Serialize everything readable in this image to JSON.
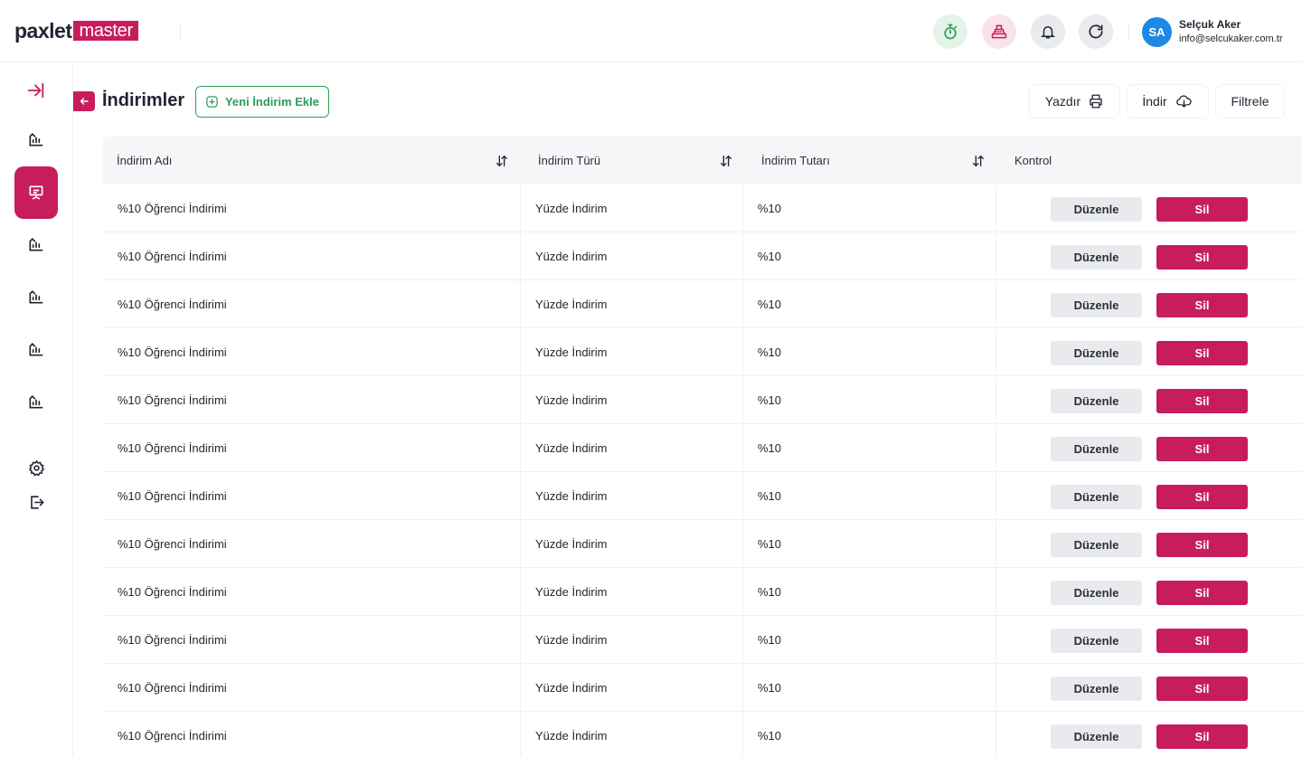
{
  "header": {
    "logo_part1": "paxlet",
    "logo_part2": "master",
    "user_initials": "SA",
    "user_name": "Selçuk Aker",
    "user_email": "info@selcukaker.com.tr"
  },
  "page": {
    "title": "İndirimler",
    "add_button": "Yeni İndirim Ekle",
    "print_button": "Yazdır",
    "download_button": "İndir",
    "filter_button": "Filtrele"
  },
  "table": {
    "columns": [
      "İndirim Adı",
      "İndirim Türü",
      "İndirim Tutarı",
      "Kontrol"
    ],
    "edit_label": "Düzenle",
    "delete_label": "Sil",
    "rows": [
      {
        "name": "%10 Öğrenci İndirimi",
        "type": "Yüzde İndirim",
        "amount": "%10"
      },
      {
        "name": "%10 Öğrenci İndirimi",
        "type": "Yüzde İndirim",
        "amount": "%10"
      },
      {
        "name": "%10 Öğrenci İndirimi",
        "type": "Yüzde İndirim",
        "amount": "%10"
      },
      {
        "name": "%10 Öğrenci İndirimi",
        "type": "Yüzde İndirim",
        "amount": "%10"
      },
      {
        "name": "%10 Öğrenci İndirimi",
        "type": "Yüzde İndirim",
        "amount": "%10"
      },
      {
        "name": "%10 Öğrenci İndirimi",
        "type": "Yüzde İndirim",
        "amount": "%10"
      },
      {
        "name": "%10 Öğrenci İndirimi",
        "type": "Yüzde İndirim",
        "amount": "%10"
      },
      {
        "name": "%10 Öğrenci İndirimi",
        "type": "Yüzde İndirim",
        "amount": "%10"
      },
      {
        "name": "%10 Öğrenci İndirimi",
        "type": "Yüzde İndirim",
        "amount": "%10"
      },
      {
        "name": "%10 Öğrenci İndirimi",
        "type": "Yüzde İndirim",
        "amount": "%10"
      },
      {
        "name": "%10 Öğrenci İndirimi",
        "type": "Yüzde İndirim",
        "amount": "%10"
      },
      {
        "name": "%10 Öğrenci İndirimi",
        "type": "Yüzde İndirim",
        "amount": "%10"
      }
    ]
  },
  "icons": {
    "top_actions": [
      "stopwatch-icon",
      "cash-register-icon",
      "bell-icon",
      "refresh-icon"
    ],
    "sidebar": [
      "collapse-icon",
      "chart-icon",
      "presentation-icon",
      "chart-icon",
      "chart-icon",
      "chart-icon",
      "chart-icon",
      "settings-icon",
      "logout-icon"
    ]
  },
  "colors": {
    "brand": "#c81d5d",
    "success": "#2e9c5a",
    "avatar": "#1e88e5"
  }
}
